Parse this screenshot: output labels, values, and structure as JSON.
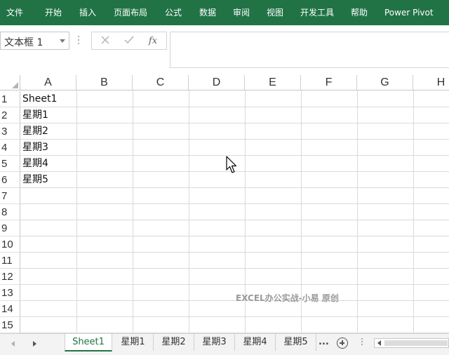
{
  "ribbon": {
    "tabs": [
      "文件",
      "开始",
      "插入",
      "页面布局",
      "公式",
      "数据",
      "审阅",
      "视图",
      "开发工具",
      "帮助",
      "Power Pivot"
    ]
  },
  "formula_bar": {
    "name_box": "文本框 1",
    "cancel_icon": "x-icon",
    "enter_icon": "check-icon",
    "fx_label": "fx",
    "formula": ""
  },
  "grid": {
    "columns": [
      "A",
      "B",
      "C",
      "D",
      "E",
      "F",
      "G",
      "H"
    ],
    "rows": [
      "1",
      "2",
      "3",
      "4",
      "5",
      "6",
      "7",
      "8",
      "9",
      "10",
      "11",
      "12",
      "13",
      "14",
      "15"
    ],
    "column_a_values": [
      "Sheet1",
      "星期1",
      "星期2",
      "星期3",
      "星期4",
      "星期5"
    ]
  },
  "watermark": "EXCEL办公实战-小易  原创",
  "sheet_tabs": {
    "tabs": [
      "Sheet1",
      "星期1",
      "星期2",
      "星期3",
      "星期4",
      "星期5"
    ],
    "active": "Sheet1",
    "more": "...",
    "add_icon": "plus-circle-icon"
  },
  "colors": {
    "ribbon": "#217346",
    "active_tab_text": "#217346"
  }
}
